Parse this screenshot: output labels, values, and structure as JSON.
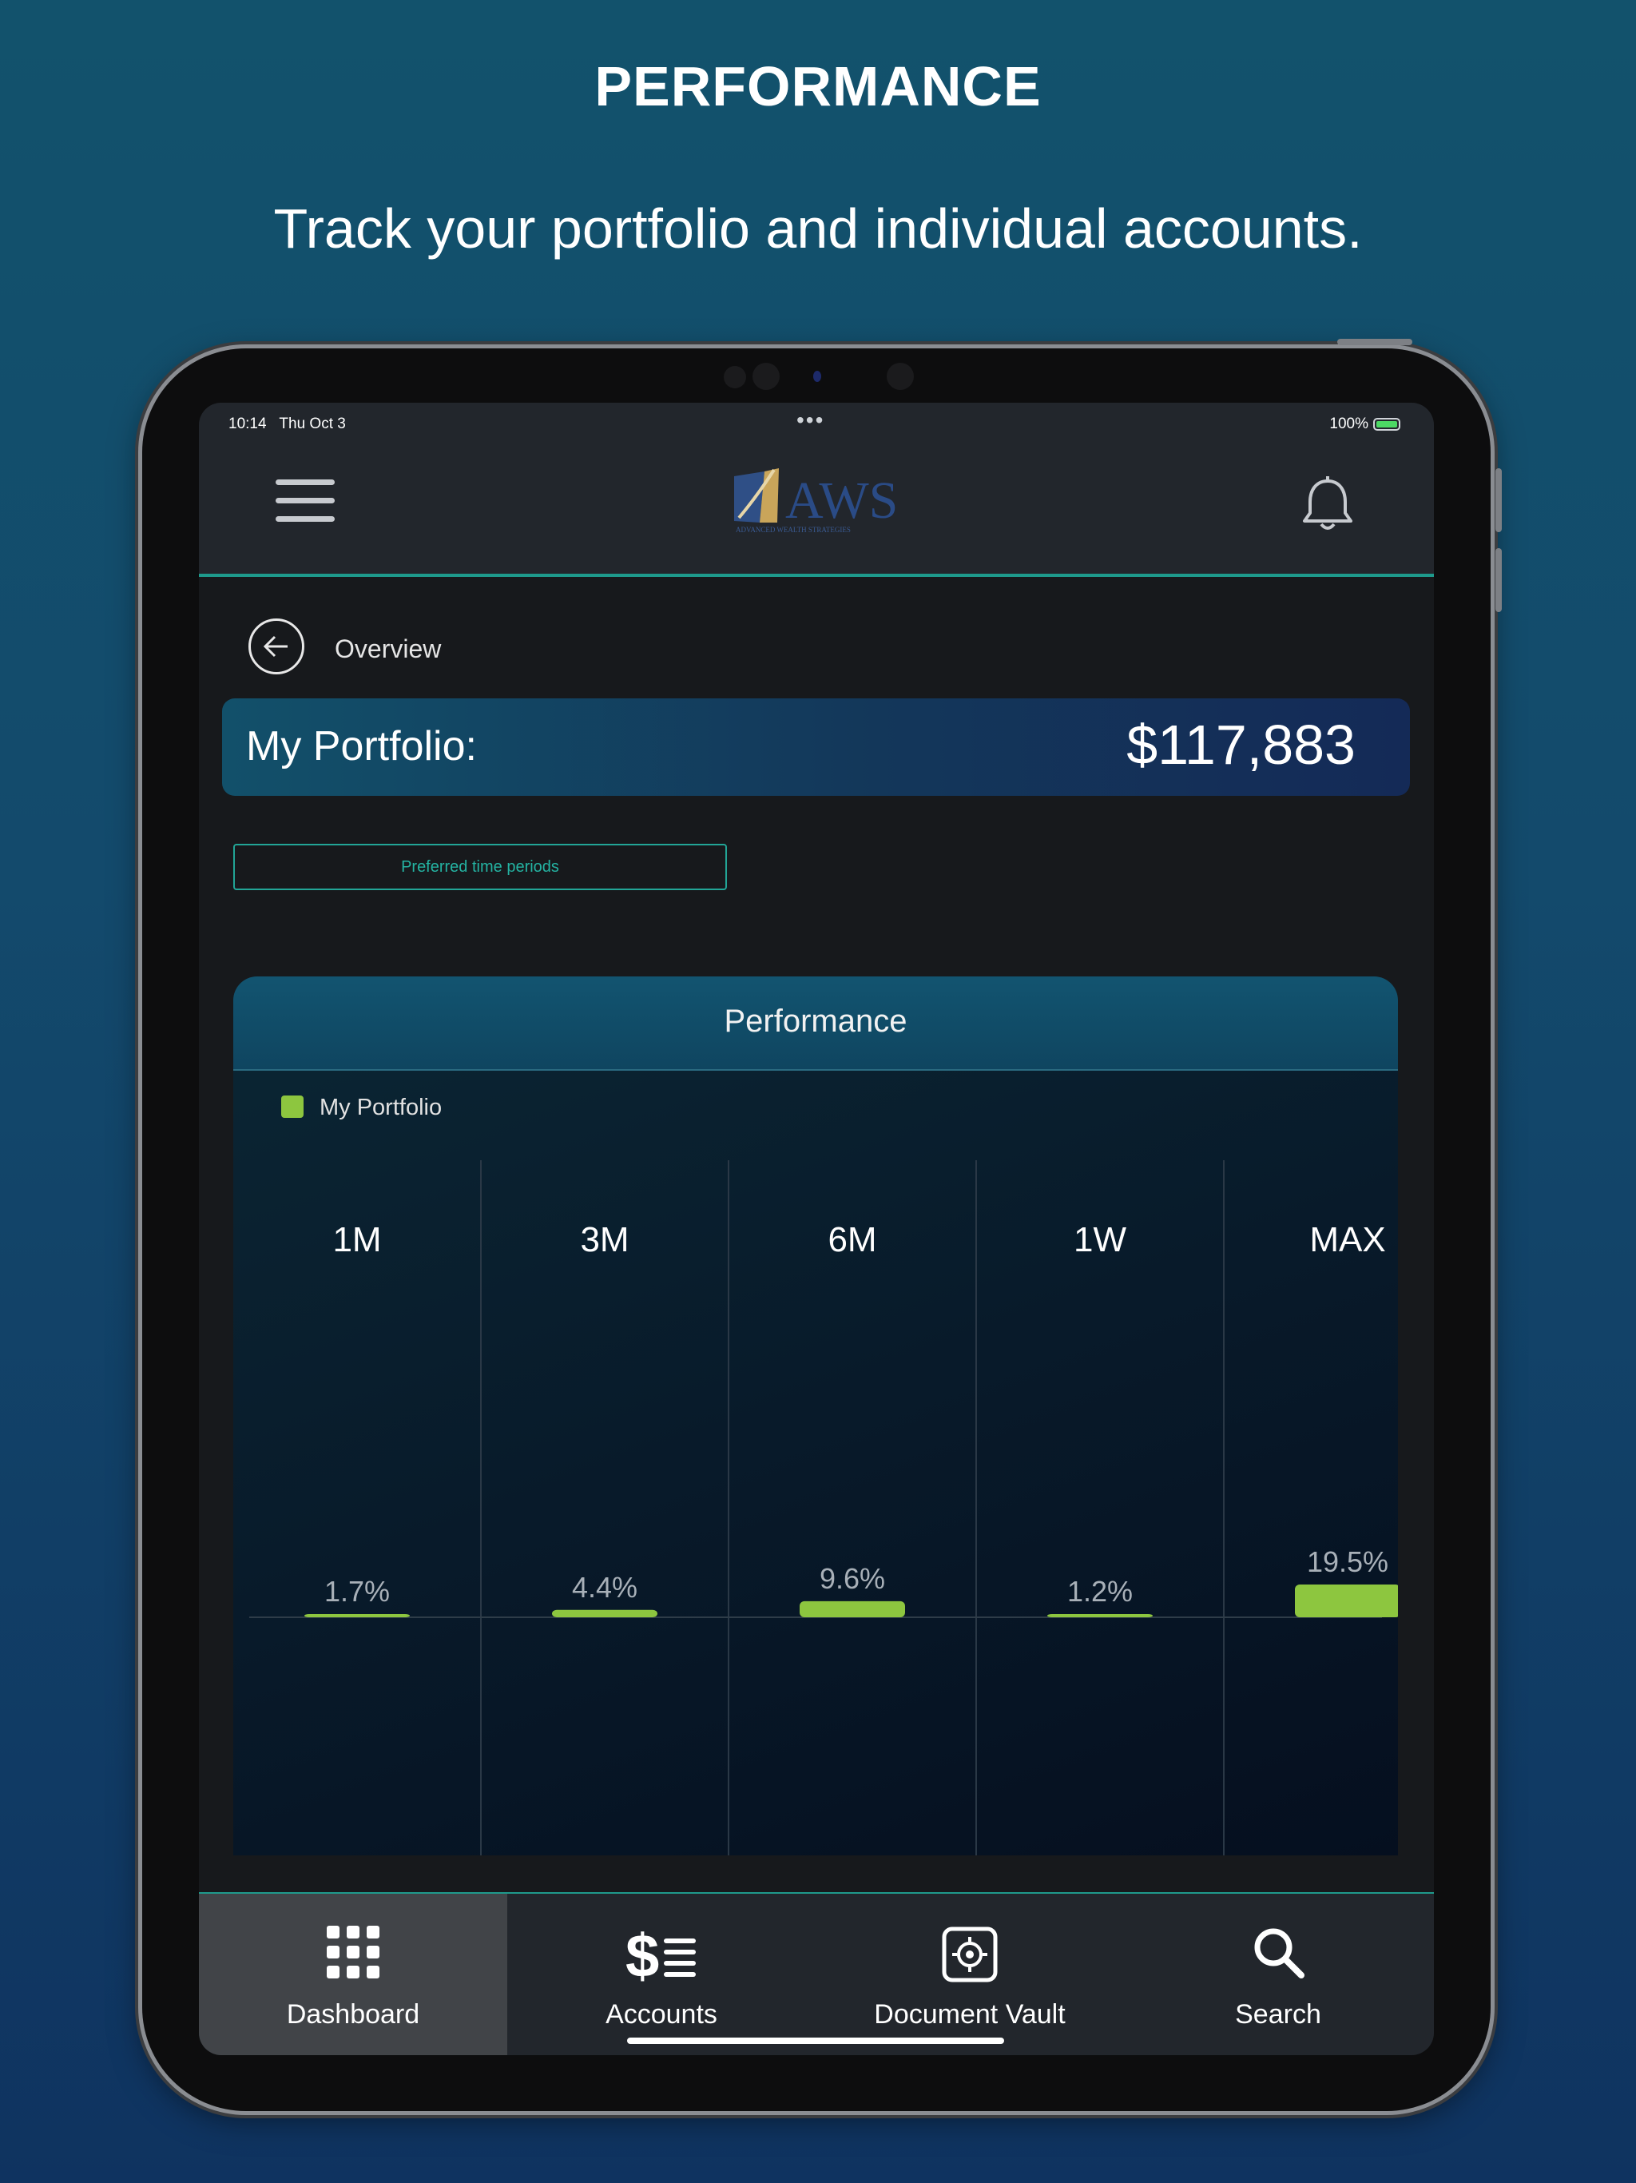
{
  "promo": {
    "headline": "PERFORMANCE",
    "subhead": "Track your portfolio and individual accounts."
  },
  "status_bar": {
    "time": "10:14",
    "date": "Thu Oct 3",
    "battery": "100%"
  },
  "app_bar": {
    "logo_text": "AWS",
    "logo_tagline": "ADVANCED WEALTH STRATEGIES"
  },
  "page": {
    "back_label": "Overview",
    "portfolio_label": "My Portfolio:",
    "portfolio_value": "$117,883",
    "period_button": "Preferred time periods"
  },
  "performance_card": {
    "title": "Performance",
    "legend": "My Portfolio"
  },
  "colors": {
    "accent_teal": "#1e9a8c",
    "bar_green": "#8dc63f"
  },
  "chart_data": {
    "type": "bar",
    "categories": [
      "1M",
      "3M",
      "6M",
      "1W",
      "MAX"
    ],
    "series": [
      {
        "name": "My Portfolio",
        "values": [
          1.7,
          4.4,
          9.6,
          1.2,
          19.5
        ]
      }
    ],
    "data_labels": [
      "1.7%",
      "4.4%",
      "9.6%",
      "1.2%",
      "19.5%"
    ],
    "unit": "%",
    "legend": "top-left",
    "grid": "vertical"
  },
  "tabs": [
    {
      "label": "Dashboard",
      "icon": "grid-icon",
      "active": true
    },
    {
      "label": "Accounts",
      "icon": "dollar-list-icon",
      "active": false
    },
    {
      "label": "Document Vault",
      "icon": "vault-icon",
      "active": false
    },
    {
      "label": "Search",
      "icon": "search-icon",
      "active": false
    }
  ]
}
